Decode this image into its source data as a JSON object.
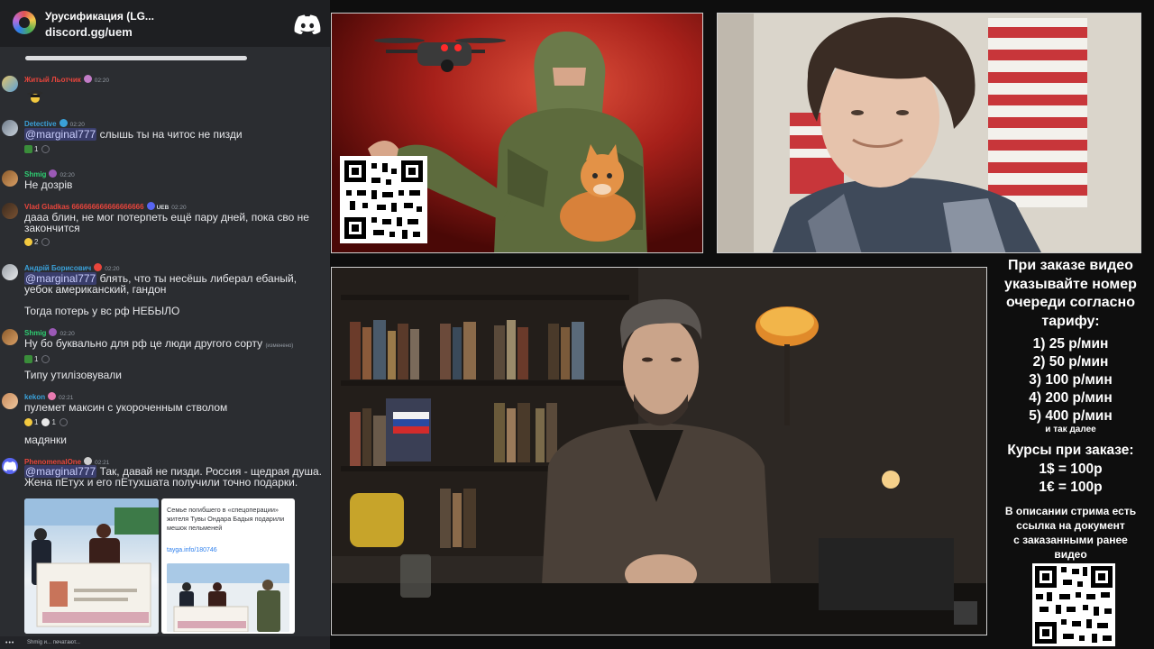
{
  "server": {
    "name": "Урусификация (LG...",
    "invite": "discord.gg/uem",
    "icon": "server-rainbow-icon",
    "logo": "discord-logo-icon"
  },
  "messages": [
    {
      "id": "m1",
      "author": "Житый Льотчик",
      "author_color": "#e8453c",
      "time": "02:20",
      "text": "",
      "sticker": "emoji-sticker-icon"
    },
    {
      "id": "m2",
      "author": "Detective",
      "author_color": "#3aa0d8",
      "time": "02:20",
      "mention": "@marginal777",
      "text": " слышь ты на читос не пизди",
      "reactions": [
        {
          "icon": "tree-emoji-icon",
          "count": "1"
        }
      ]
    },
    {
      "id": "m3",
      "author": "Shmig",
      "author_color": "#2ecc71",
      "time": "02:20",
      "text": "Не дозрів"
    },
    {
      "id": "m4",
      "author": "Vlad Gladkas 666666666666666666",
      "author_color": "#e8453c",
      "tag": "UEB",
      "time": "02:20",
      "text": "дааа блин, не мог потерпеть ещё пару дней, пока сво не закончится",
      "reactions": [
        {
          "icon": "laughing-emoji-icon",
          "count": "2"
        }
      ]
    },
    {
      "id": "m5",
      "author": "Андрій Борисович",
      "author_color": "#3aa0d8",
      "time": "02:20",
      "mention": "@marginal777",
      "text": " блять, что ты несёшь либерал ебаный, уебок американский, гандон",
      "text2": "Тогда потерь у вс рф НЕБЫЛО"
    },
    {
      "id": "m6",
      "author": "Shmig",
      "author_color": "#2ecc71",
      "time": "02:20",
      "text": "Ну бо буквально для рф це люди другого сорту",
      "edited": "(изменено)",
      "reactions": [
        {
          "icon": "tree-emoji-icon",
          "count": "1"
        }
      ],
      "text2": "Типу утилізовували"
    },
    {
      "id": "m7",
      "author": "kekon",
      "author_color": "#3aa0d8",
      "time": "02:21",
      "text": "пулемет максин с укороченным стволом",
      "reactions": [
        {
          "icon": "laughing-emoji-icon",
          "count": "1"
        },
        {
          "icon": "skull-emoji-icon",
          "count": "1"
        }
      ],
      "text2": "мадянки"
    },
    {
      "id": "m8",
      "author": "PhenomenalOne",
      "author_color": "#e8453c",
      "time": "02:21",
      "mention": "@marginal777",
      "text": " Так, давай не пизди. Россия - щедрая душа. Жена пЕтух и его пЕтухшата получили точно подарки."
    }
  ],
  "embed": {
    "title": "Семье погибшего в «спецоперации» жителя Тувы Ондара Бадыя подарили мешок пельменей",
    "link": "tayga.info/180746"
  },
  "typing": {
    "dots": "•••",
    "text": "Shmig и... печатают..."
  },
  "info": {
    "title_lines": [
      "При заказе видео",
      "указывайте номер",
      "очереди согласно",
      "тарифу:"
    ],
    "prices": [
      "1) 25 р/мин",
      "2) 50 р/мин",
      "3) 100 р/мин",
      "4) 200 р/мин",
      "5) 400 р/мин"
    ],
    "etc": "и так далее",
    "rates_title": "Курсы при заказе:",
    "rates": [
      "1$ = 100р",
      "1€ = 100р"
    ],
    "desc_lines": [
      "В описании стрима есть",
      "ссылка на документ",
      "с заказанными ранее",
      "видео"
    ]
  },
  "videos": {
    "top_left": "illustration-soldier-drone-cat",
    "top_right": "webcam-streamer-flag",
    "main": "studio-speaker-bookshelf"
  }
}
